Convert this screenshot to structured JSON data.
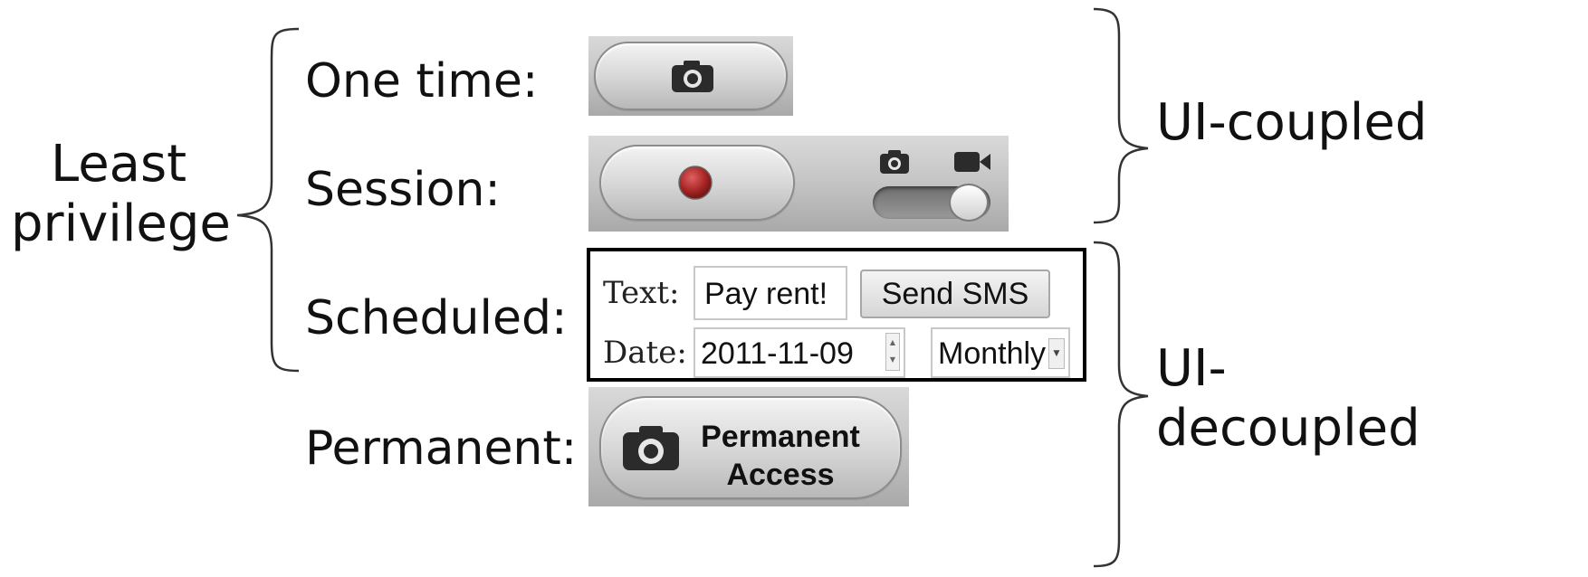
{
  "group_left": {
    "label_line1": "Least",
    "label_line2": "privilege"
  },
  "group_right_top": {
    "label": "UI-coupled"
  },
  "group_right_bottom": {
    "label_line1": "UI-",
    "label_line2": "decoupled"
  },
  "rows": {
    "one_time": {
      "label": "One time:"
    },
    "session": {
      "label": "Session:"
    },
    "scheduled": {
      "label": "Scheduled:",
      "text_label": "Text:",
      "text_value": "Pay rent!",
      "send_button": "Send SMS",
      "date_label": "Date:",
      "date_value": "2011-11-09",
      "frequency_value": "Monthly"
    },
    "permanent": {
      "label": "Permanent:",
      "button_line1": "Permanent",
      "button_line2": "Access"
    }
  },
  "icons": {
    "camera": "camera-icon",
    "record": "record-icon",
    "video": "video-camera-icon",
    "toggle": "toggle-switch"
  },
  "colors": {
    "record_red": "#b5302f",
    "panel_gray": "#c6c6c6"
  }
}
